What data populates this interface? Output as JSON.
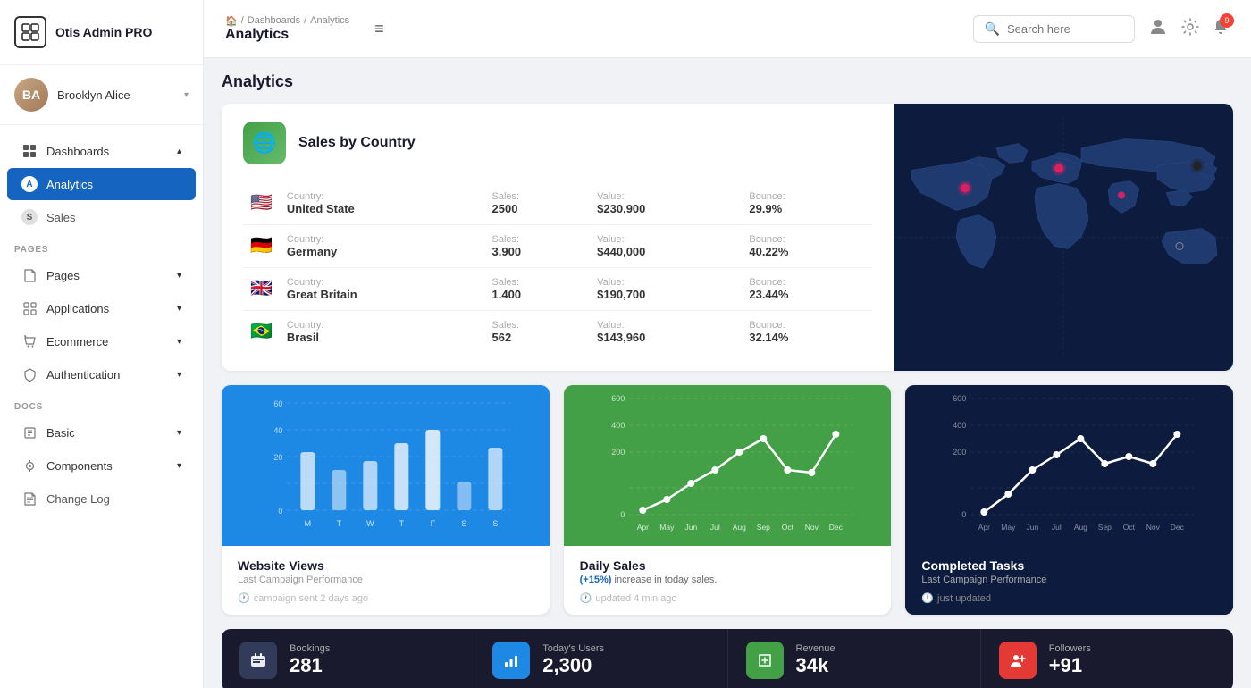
{
  "app": {
    "name": "Otis Admin PRO"
  },
  "user": {
    "name": "Brooklyn Alice",
    "initials": "BA"
  },
  "sidebar": {
    "sections": [
      {
        "label": "",
        "items": [
          {
            "id": "dashboards",
            "label": "Dashboards",
            "icon": "⊞",
            "hasChildren": true,
            "expanded": true
          },
          {
            "id": "analytics",
            "label": "Analytics",
            "icon": "A",
            "active": true
          },
          {
            "id": "sales",
            "label": "Sales",
            "icon": "S"
          }
        ]
      },
      {
        "label": "PAGES",
        "items": [
          {
            "id": "pages",
            "label": "Pages",
            "icon": "🗋",
            "hasChildren": true
          },
          {
            "id": "applications",
            "label": "Applications",
            "icon": "⊞",
            "hasChildren": true
          },
          {
            "id": "ecommerce",
            "label": "Ecommerce",
            "icon": "🛍",
            "hasChildren": true
          },
          {
            "id": "authentication",
            "label": "Authentication",
            "icon": "🔖",
            "hasChildren": true
          }
        ]
      },
      {
        "label": "DOCS",
        "items": [
          {
            "id": "basic",
            "label": "Basic",
            "icon": "📚",
            "hasChildren": true
          },
          {
            "id": "components",
            "label": "Components",
            "icon": "⚙",
            "hasChildren": true
          },
          {
            "id": "changelog",
            "label": "Change Log",
            "icon": "📋"
          }
        ]
      }
    ]
  },
  "topbar": {
    "hamburger": "≡",
    "breadcrumbs": [
      "🏠",
      "/",
      "Dashboards",
      "/",
      "Analytics"
    ],
    "page_title": "Analytics",
    "search_placeholder": "Search here",
    "notification_count": "9"
  },
  "sales_country": {
    "title": "Sales by Country",
    "icon": "🌐",
    "columns": [
      "Country:",
      "Sales:",
      "Value:",
      "Bounce:"
    ],
    "rows": [
      {
        "flag": "🇺🇸",
        "country": "United State",
        "sales": "2500",
        "value": "$230,900",
        "bounce": "29.9%"
      },
      {
        "flag": "🇩🇪",
        "country": "Germany",
        "sales": "3.900",
        "value": "$440,000",
        "bounce": "40.22%"
      },
      {
        "flag": "🇬🇧",
        "country": "Great Britain",
        "sales": "1.400",
        "value": "$190,700",
        "bounce": "23.44%"
      },
      {
        "flag": "🇧🇷",
        "country": "Brasil",
        "sales": "562",
        "value": "$143,960",
        "bounce": "32.14%"
      }
    ]
  },
  "charts": {
    "website_views": {
      "title": "Website Views",
      "subtitle": "Last Campaign Performance",
      "meta": "campaign sent 2 days ago",
      "y_labels": [
        "60",
        "40",
        "20",
        "0"
      ],
      "x_labels": [
        "M",
        "T",
        "W",
        "T",
        "F",
        "S",
        "S"
      ],
      "bars": [
        35,
        20,
        28,
        40,
        55,
        15,
        45
      ]
    },
    "daily_sales": {
      "title": "Daily Sales",
      "highlight": "(+15%)",
      "subtitle": " increase in today sales.",
      "meta": "updated 4 min ago",
      "y_labels": [
        "600",
        "400",
        "200",
        "0"
      ],
      "x_labels": [
        "Apr",
        "May",
        "Jun",
        "Jul",
        "Aug",
        "Sep",
        "Oct",
        "Nov",
        "Dec"
      ],
      "points": [
        20,
        80,
        180,
        280,
        380,
        460,
        280,
        260,
        480
      ]
    },
    "completed_tasks": {
      "title": "Completed Tasks",
      "subtitle": "Last Campaign Performance",
      "meta": "just updated",
      "y_labels": [
        "600",
        "400",
        "200",
        "0"
      ],
      "x_labels": [
        "Apr",
        "May",
        "Jun",
        "Jul",
        "Aug",
        "Sep",
        "Oct",
        "Nov",
        "Dec"
      ],
      "points": [
        20,
        100,
        220,
        320,
        400,
        300,
        350,
        300,
        460
      ]
    }
  },
  "stats": [
    {
      "icon": "🛋",
      "icon_style": "dark",
      "label": "Bookings",
      "value": "281"
    },
    {
      "icon": "📊",
      "icon_style": "blue",
      "label": "Today's Users",
      "value": "2,300"
    },
    {
      "icon": "🏪",
      "icon_style": "green",
      "label": "Revenue",
      "value": "34k"
    },
    {
      "icon": "👤",
      "icon_style": "red",
      "label": "Followers",
      "value": "+91"
    }
  ]
}
